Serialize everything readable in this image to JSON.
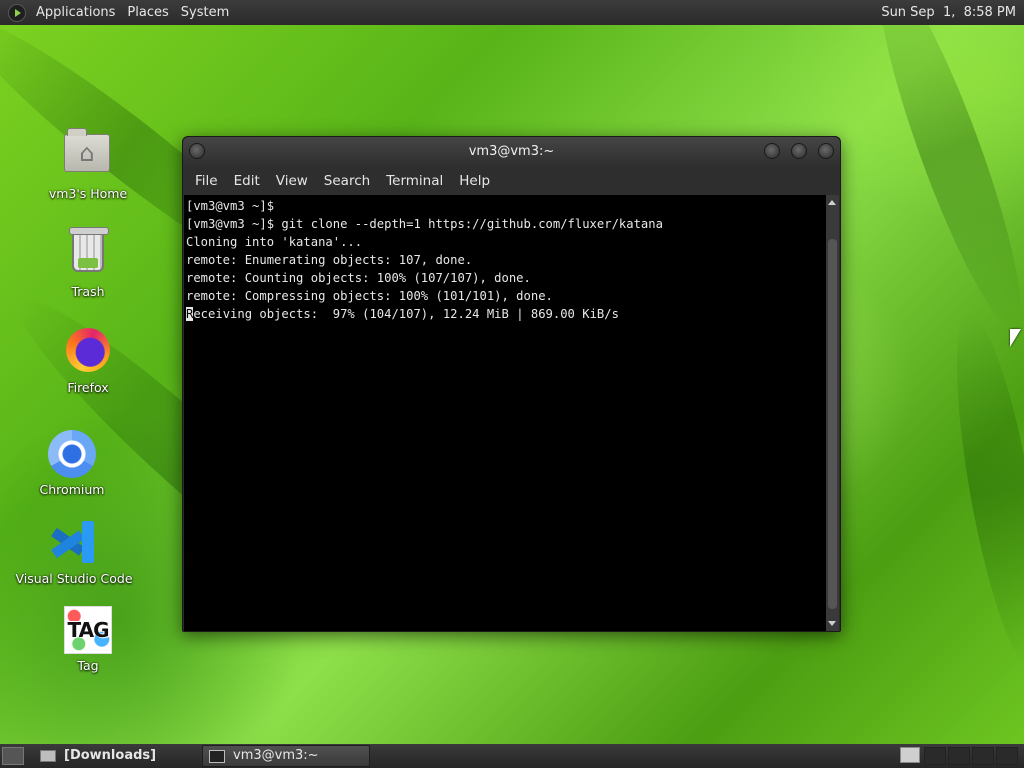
{
  "top_panel": {
    "menu": [
      "Applications",
      "Places",
      "System"
    ],
    "clock": "Sun Sep  1,  8:58 PM"
  },
  "desktop_icons": [
    {
      "label": "vm3's Home",
      "icon": "home-folder-icon"
    },
    {
      "label": "Trash",
      "icon": "trash-icon"
    },
    {
      "label": "Firefox",
      "icon": "firefox-icon"
    },
    {
      "label": "Chromium",
      "icon": "chromium-icon"
    },
    {
      "label": "Visual Studio Code",
      "icon": "vscode-icon"
    },
    {
      "label": "Tag",
      "icon": "tag-icon"
    }
  ],
  "terminal": {
    "title": "vm3@vm3:~",
    "menu": [
      "File",
      "Edit",
      "View",
      "Search",
      "Terminal",
      "Help"
    ],
    "lines": [
      "[vm3@vm3 ~]$",
      "[vm3@vm3 ~]$ git clone --depth=1 https://github.com/fluxer/katana",
      "Cloning into 'katana'...",
      "remote: Enumerating objects: 107, done.",
      "remote: Counting objects: 100% (107/107), done.",
      "remote: Compressing objects: 100% (101/101), done."
    ],
    "progress_cursor_char": "R",
    "progress_line_rest": "eceiving objects:  97% (104/107), 12.24 MiB | 869.00 KiB/s"
  },
  "bottom_panel": {
    "tasks": [
      {
        "label": "[Downloads]",
        "icon": "folder-icon"
      },
      {
        "label": "vm3@vm3:~",
        "icon": "terminal-icon"
      }
    ]
  }
}
